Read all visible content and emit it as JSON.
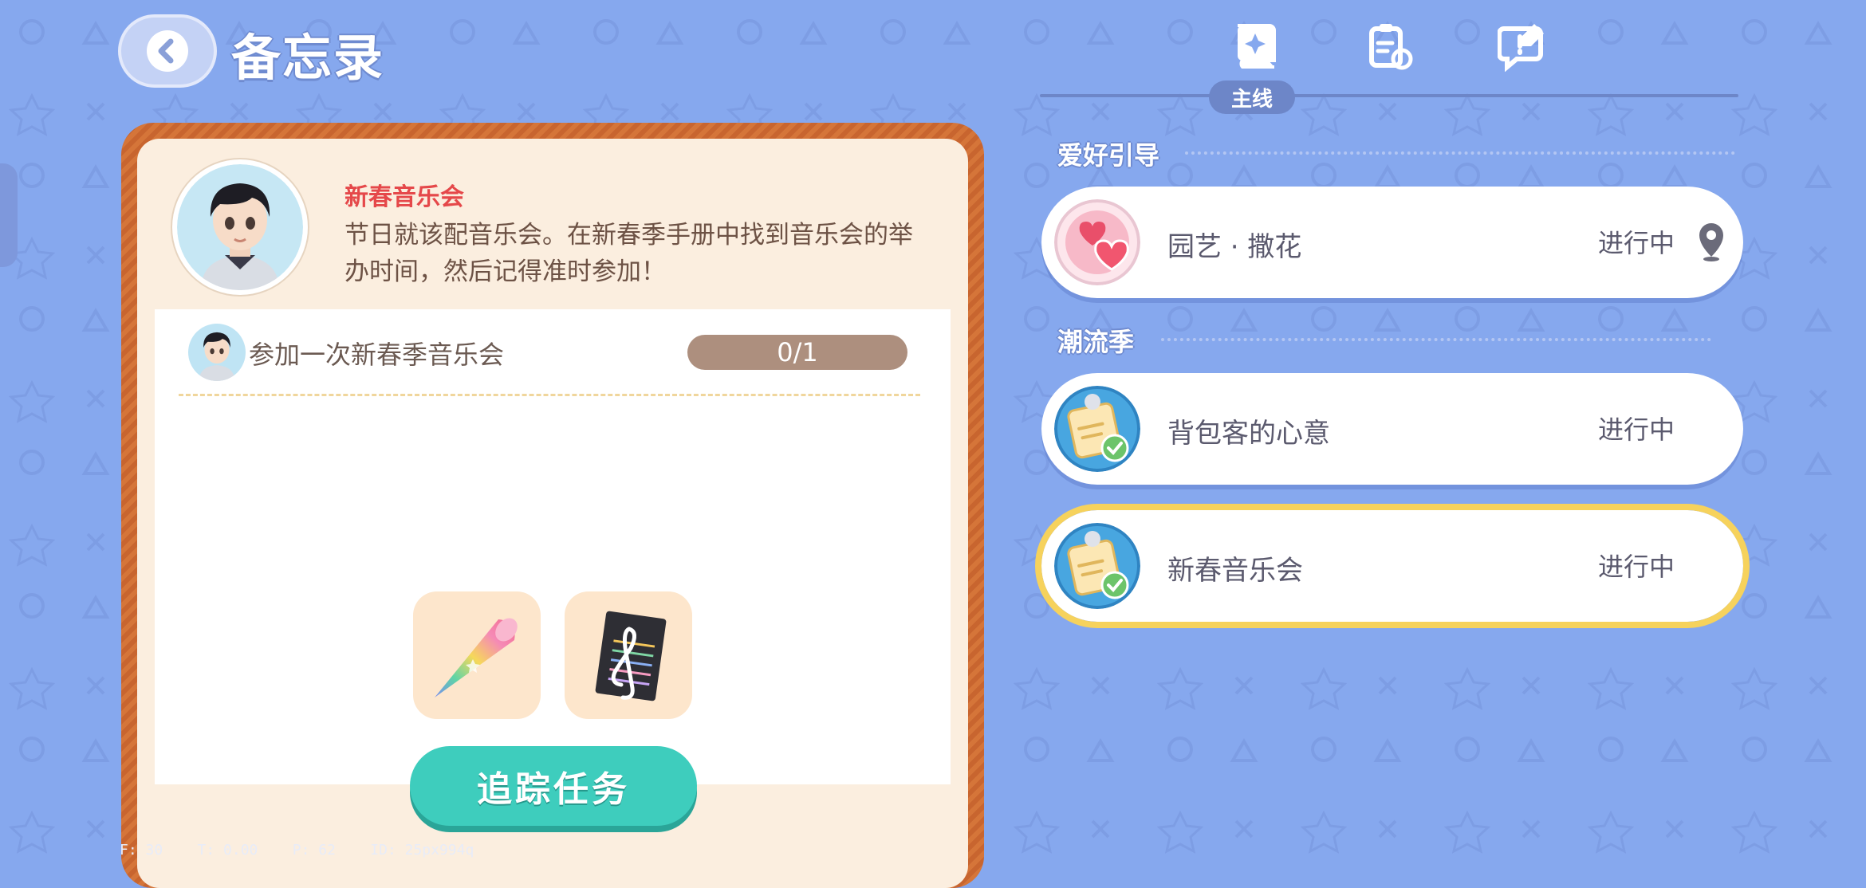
{
  "header": {
    "title": "备忘录",
    "back_icon": "back-arrow-icon"
  },
  "tabs": {
    "items": [
      {
        "icon": "book-star-icon"
      },
      {
        "icon": "clipboard-refresh-icon"
      },
      {
        "icon": "chat-pencil-icon"
      }
    ],
    "active_label": "主线"
  },
  "memo": {
    "quest_name": "新春音乐会",
    "description": "节日就该配音乐会。在新春季手册中找到音乐会的举办时间，然后记得准时参加！",
    "task": {
      "label": "参加一次新春季音乐会",
      "progress": "0/1"
    },
    "rewards": [
      {
        "icon": "rainbow-cone-icon"
      },
      {
        "icon": "sheet-music-icon"
      }
    ],
    "track_button": "追踪任务",
    "debug": "F: 30    T: 0.00    P: 62    ID: 25px994q"
  },
  "sections": [
    {
      "title": "爱好引导",
      "quests": [
        {
          "name": "园艺 · 撒花",
          "status": "进行中",
          "icon": "heart-bubble-icon",
          "pin_icon": "location-pin-icon"
        }
      ]
    },
    {
      "title": "潮流季",
      "quests": [
        {
          "name": "背包客的心意",
          "status": "进行中",
          "icon": "note-check-icon"
        },
        {
          "name": "新春音乐会",
          "status": "进行中",
          "icon": "note-check-icon",
          "selected": true
        }
      ]
    }
  ],
  "colors": {
    "background": "#86a8ee",
    "accent_teal": "#3ecdbd",
    "frame_orange": "#c8652f",
    "quest_title_red": "#e5484a",
    "selected_outline": "#f6d25c"
  }
}
